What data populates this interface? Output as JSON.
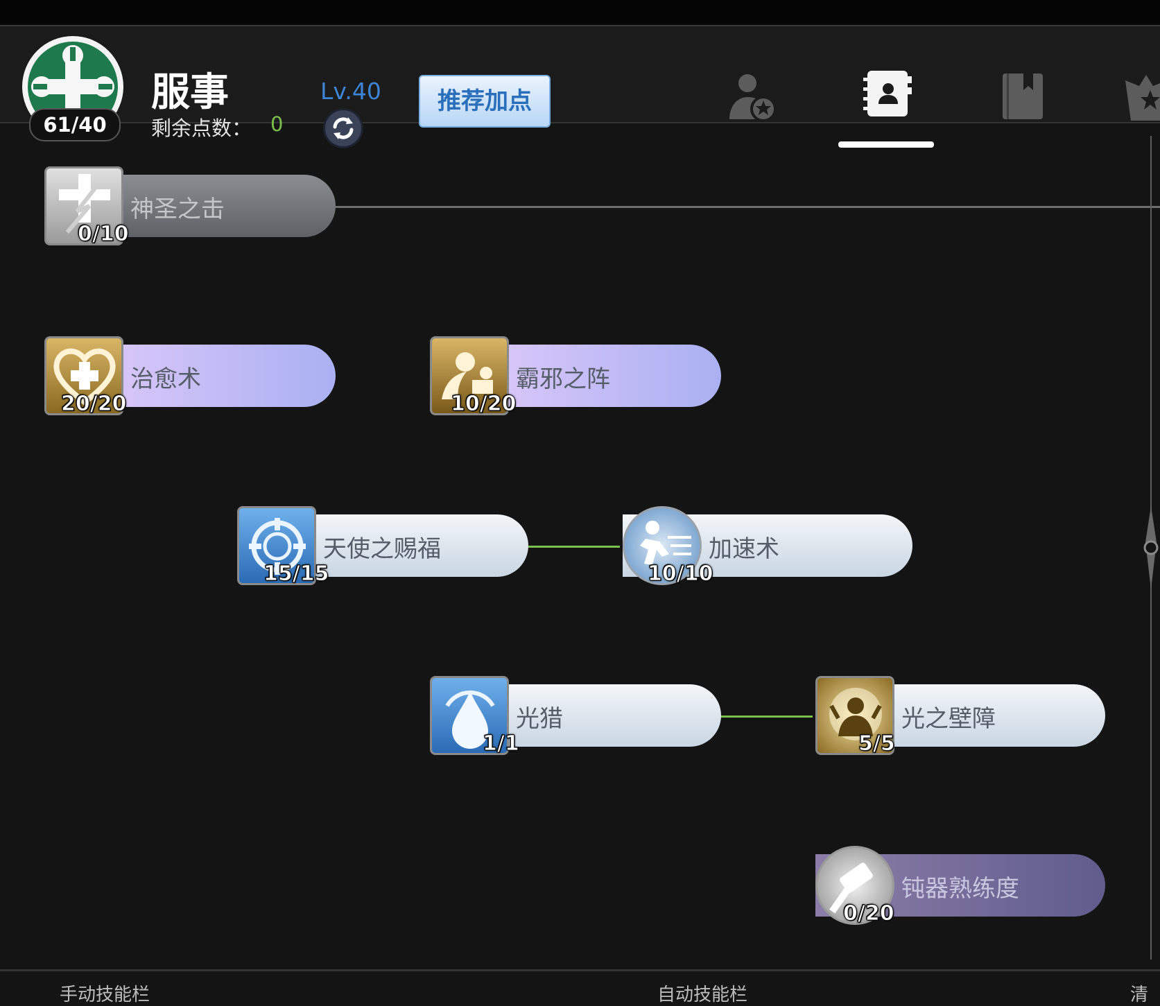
{
  "header": {
    "job_points": "61/40",
    "job_title": "服事",
    "remain_label": "剩余点数：",
    "remain_value": "0",
    "level": "Lv.40",
    "recommend_label": "推荐加点"
  },
  "tabs": [
    {
      "name": "character-info-tab",
      "active": false
    },
    {
      "name": "skill-book-tab",
      "active": true
    },
    {
      "name": "bookmark-tab",
      "active": false
    },
    {
      "name": "emblem-tab",
      "active": false
    }
  ],
  "skills": [
    {
      "id": "holy-strike",
      "name": "神圣之击",
      "level": "0/10",
      "style": "locked",
      "icon": "holy-cross-icon"
    },
    {
      "id": "heal",
      "name": "治愈术",
      "level": "20/20",
      "style": "purple",
      "icon": "heart-cross-icon"
    },
    {
      "id": "magnificat",
      "name": "霸邪之阵",
      "level": "10/20",
      "style": "purple",
      "icon": "angel-ward-icon"
    },
    {
      "id": "blessing",
      "name": "天使之赐福",
      "level": "15/15",
      "style": "light",
      "icon": "blessing-ring-icon"
    },
    {
      "id": "increase-agi",
      "name": "加速术",
      "level": "10/10",
      "style": "light",
      "icon": "sprint-icon"
    },
    {
      "id": "ruwach",
      "name": "光猎",
      "level": "1/1",
      "style": "light",
      "icon": "light-drop-icon"
    },
    {
      "id": "pneuma",
      "name": "光之壁障",
      "level": "5/5",
      "style": "light",
      "icon": "light-barrier-icon"
    },
    {
      "id": "mace-mastery",
      "name": "钝器熟练度",
      "level": "0/20",
      "style": "dark-purple",
      "icon": "hammer-icon"
    }
  ],
  "colors": {
    "accent_blue": "#3d84d6",
    "remain_green": "#7bc04a",
    "link_green": "#7bc04a",
    "purple_pill": "#c9b7f5",
    "light_pill": "#e3eaf1",
    "locked_pill": "#6a6e72",
    "dark_purple_pill": "#6a6496"
  },
  "footer": {
    "left_label": "手动技能栏",
    "mid_label": "自动技能栏",
    "right_label": "清"
  }
}
